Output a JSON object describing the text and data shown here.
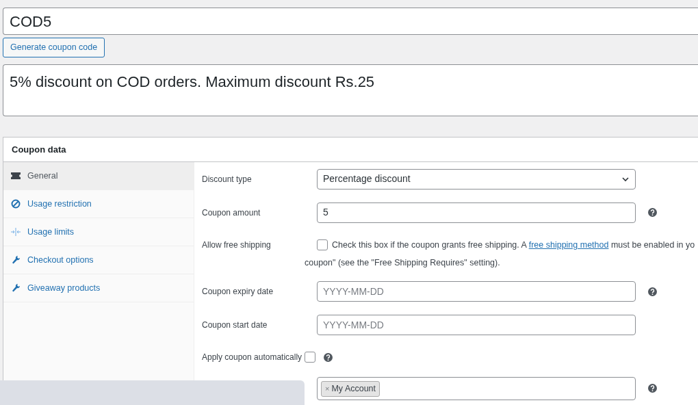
{
  "coupon_code": {
    "value": "COD5"
  },
  "generate_button": {
    "label": "Generate coupon code"
  },
  "description": {
    "value": "5% discount on COD orders. Maximum discount Rs.25"
  },
  "panel": {
    "title": "Coupon data"
  },
  "tabs": [
    {
      "label": "General",
      "kind": "ticket",
      "selected": true
    },
    {
      "label": "Usage restriction",
      "kind": "block",
      "selected": false
    },
    {
      "label": "Usage limits",
      "kind": "limits",
      "selected": false
    },
    {
      "label": "Checkout options",
      "kind": "wrench",
      "selected": false
    },
    {
      "label": "Giveaway products",
      "kind": "wrench",
      "selected": false
    }
  ],
  "fields": [
    {
      "kind": "select",
      "label": "Discount type",
      "value": "Percentage discount",
      "help": false
    },
    {
      "kind": "text",
      "label": "Coupon amount",
      "value": "5",
      "help": true
    },
    {
      "kind": "checkbox",
      "label": "Allow free shipping",
      "checked": false,
      "help": false,
      "text_before": "Check this box if the coupon grants free shipping. A ",
      "link": "free shipping method",
      "text_after": " must be enabled in yo",
      "line_2": "coupon\" (see the \"Free Shipping Requires\" setting)."
    },
    {
      "kind": "text",
      "label": "Coupon expiry date",
      "placeholder": "YYYY-MM-DD",
      "help": true
    },
    {
      "kind": "text",
      "label": "Coupon start date",
      "placeholder": "YYYY-MM-DD",
      "help": false
    },
    {
      "kind": "checkbox",
      "label": "Apply coupon automatically",
      "checked": false,
      "help": true
    },
    {
      "kind": "tags",
      "tags": [
        {
          "remove": "×",
          "label": "My Account"
        }
      ],
      "help": true
    }
  ]
}
